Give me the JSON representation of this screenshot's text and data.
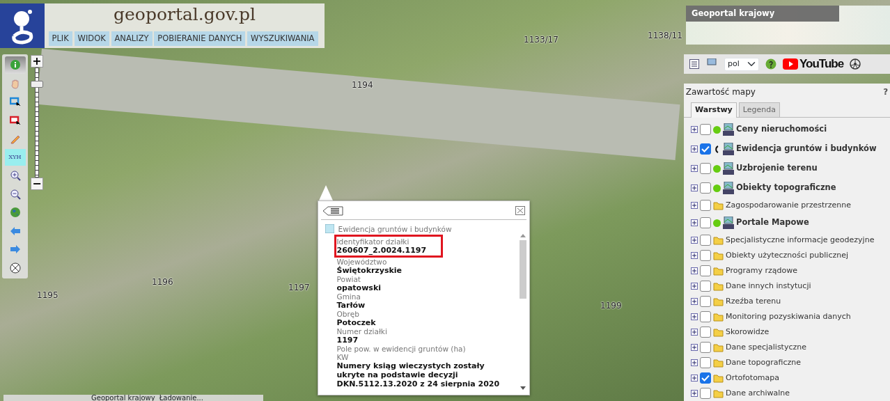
{
  "header": {
    "logo_text": "geoportal.gov.pl",
    "menu": [
      "PLIK",
      "WIDOK",
      "ANALIZY",
      "POBIERANIE DANYCH",
      "WYSZUKIWANIA"
    ]
  },
  "map_labels": [
    "1133/17",
    "1138/11",
    "1194",
    "1196",
    "1195",
    "1197",
    "1199"
  ],
  "tools": [
    {
      "kind": "info",
      "selected": true
    },
    {
      "kind": "hand",
      "selected": false
    },
    {
      "kind": "select-blue",
      "selected": false
    },
    {
      "kind": "select-red",
      "selected": false
    },
    {
      "kind": "pencil",
      "selected": false
    },
    {
      "kind": "xyh",
      "label": "XYH",
      "selected": false
    },
    {
      "kind": "zoom-in",
      "selected": false
    },
    {
      "kind": "zoom-out",
      "selected": false
    },
    {
      "kind": "globe",
      "selected": false
    },
    {
      "kind": "back",
      "selected": false
    },
    {
      "kind": "forward",
      "selected": false
    },
    {
      "kind": "clear",
      "selected": false
    }
  ],
  "zoom": {
    "plus": "+",
    "minus": "−",
    "level": 0.85
  },
  "overview": {
    "title": "Geoportal krajowy"
  },
  "toolbar": {
    "language": "pol",
    "video_label": "YouTube"
  },
  "popup": {
    "layer": "Ewidencja gruntów i budynków",
    "fields": [
      {
        "label": "Identyfikator działki",
        "value": "260607_2.0024.1197",
        "highlighted": true
      },
      {
        "label": "Województwo",
        "value": "Świętokrzyskie",
        "highlighted": false
      },
      {
        "label": "Powiat",
        "value": "opatowski",
        "highlighted": false
      },
      {
        "label": "Gmina",
        "value": "Tarłów",
        "highlighted": false
      },
      {
        "label": "Obręb",
        "value": "Potoczek",
        "highlighted": false
      },
      {
        "label": "Numer działki",
        "value": "1197",
        "highlighted": false
      },
      {
        "label": "Pole pow. w ewidencji gruntów (ha)",
        "highlighted": false
      },
      {
        "label": "KW",
        "value": "Numery ksiąg wieczystych zostały ukryte na podstawie decyzji DKN.5112.13.2020 z 24 sierpnia 2020",
        "highlighted": false
      }
    ]
  },
  "panel": {
    "title": "Zawartość mapy",
    "help": "?",
    "tabs": [
      {
        "label": "Warstwy",
        "selected": true
      },
      {
        "label": "Legenda",
        "selected": false
      }
    ],
    "layers": [
      {
        "label": "Ceny nieruchomości",
        "kind": "wms",
        "loading": false,
        "checked": false
      },
      {
        "label": "Ewidencja gruntów i budynków",
        "kind": "wms",
        "loading": true,
        "checked": true
      },
      {
        "label": "Uzbrojenie terenu",
        "kind": "wms",
        "loading": false,
        "checked": false
      },
      {
        "label": "Obiekty topograficzne",
        "kind": "wms",
        "loading": false,
        "checked": false
      },
      {
        "label": "Zagospodarowanie przestrzenne",
        "kind": "folder",
        "checked": false
      },
      {
        "label": "Portale Mapowe",
        "kind": "wms",
        "loading": false,
        "checked": false
      },
      {
        "label": "Specjalistyczne informacje geodezyjne",
        "kind": "folder",
        "checked": false
      },
      {
        "label": "Obiekty użyteczności publicznej",
        "kind": "folder",
        "checked": false
      },
      {
        "label": "Programy rządowe",
        "kind": "folder",
        "checked": false
      },
      {
        "label": "Dane innych instytucji",
        "kind": "folder",
        "checked": false
      },
      {
        "label": "Rzeźba terenu",
        "kind": "folder",
        "checked": false
      },
      {
        "label": "Monitoring pozyskiwania danych",
        "kind": "folder",
        "checked": false
      },
      {
        "label": "Skorowidze",
        "kind": "folder",
        "checked": false
      },
      {
        "label": "Dane specjalistyczne",
        "kind": "folder",
        "checked": false
      },
      {
        "label": "Dane topograficzne",
        "kind": "folder",
        "checked": false
      },
      {
        "label": "Ortofotomapa",
        "kind": "folder",
        "checked": true
      },
      {
        "label": "Dane archiwalne",
        "kind": "folder",
        "checked": false
      }
    ]
  },
  "status_bar": {
    "source": "Geoportal krajowy",
    "message": "Ładowanie..."
  }
}
